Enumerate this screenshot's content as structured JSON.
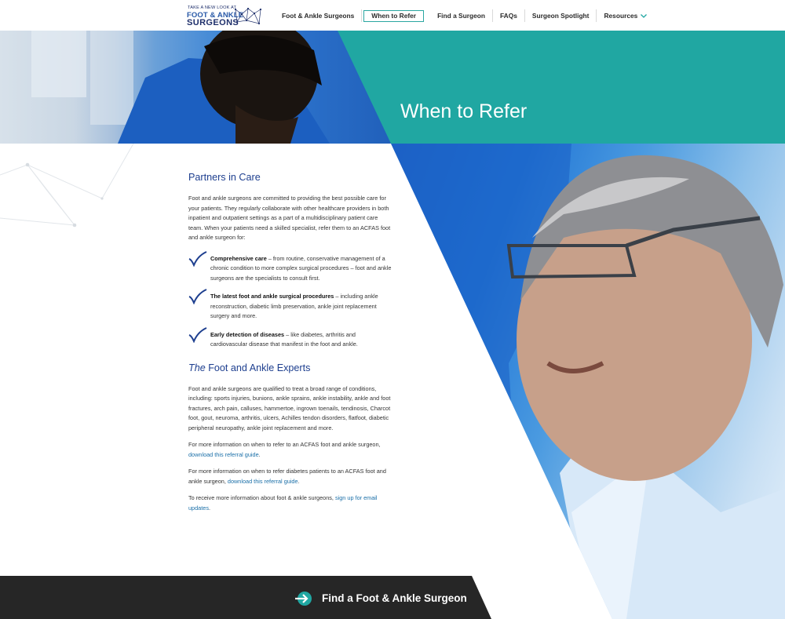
{
  "logo": {
    "tagline": "TAKE A NEW LOOK AT",
    "line1": "FOOT & ANKLE",
    "line2": "SURGEONS"
  },
  "nav": {
    "items": [
      {
        "label": "Foot & Ankle Surgeons"
      },
      {
        "label": "When to Refer",
        "active": true
      },
      {
        "label": "Find a Surgeon"
      },
      {
        "label": "FAQs"
      },
      {
        "label": "Surgeon Spotlight"
      },
      {
        "label": "Resources",
        "has_dropdown": true
      }
    ]
  },
  "hero": {
    "title": "When to Refer"
  },
  "colors": {
    "teal": "#20a7a2",
    "heading_blue": "#1e3f8f",
    "link": "#1a6fa8",
    "cta_bg": "#262626"
  },
  "section1": {
    "heading": "Partners in Care",
    "intro": "Foot and ankle surgeons are committed to providing the best possible care for your patients. They regularly collaborate with other healthcare providers in both inpatient and outpatient settings as a part of a multidisciplinary patient care team. When your patients need a skilled specialist, refer them to an ACFAS foot and ankle surgeon for:",
    "checks": [
      {
        "bold": "Comprehensive care",
        "text": " – from routine, conservative management of a chronic condition to more complex surgical procedures – foot and ankle surgeons are the specialists to consult first."
      },
      {
        "bold": "The latest foot and ankle surgical procedures",
        "text": " – including ankle reconstruction, diabetic limb preservation, ankle joint replacement surgery and more."
      },
      {
        "bold": "Early detection of diseases",
        "text": " – like diabetes, arthritis and cardiovascular disease that manifest in the foot and ankle."
      }
    ]
  },
  "section2": {
    "heading_em": "The",
    "heading_rest": " Foot and Ankle Experts",
    "body": "Foot and ankle surgeons are qualified to treat a broad range of conditions, including: sports injuries, bunions, ankle sprains, ankle instability, ankle and foot fractures, arch pain, calluses, hammertoe, ingrown toenails, tendinosis, Charcot foot, gout, neuroma, arthritis, ulcers, Achilles tendon disorders, flatfoot, diabetic peripheral neuropathy, ankle joint replacement and more.",
    "para2_text": "For more information on when to refer to an ACFAS foot and ankle surgeon, ",
    "para2_link": "download this referral guide",
    "para2_end": ".",
    "para3_text": "For more information on when to refer diabetes patients to an ACFAS foot and ankle surgeon, ",
    "para3_link": "download this referral guide",
    "para3_end": ".",
    "para4_text": "To receive more information about foot & ankle surgeons, ",
    "para4_link": "sign up for email updates",
    "para4_end": "."
  },
  "cta": {
    "label": "Find a Foot & Ankle Surgeon",
    "icon": "arrow-circle-icon"
  }
}
